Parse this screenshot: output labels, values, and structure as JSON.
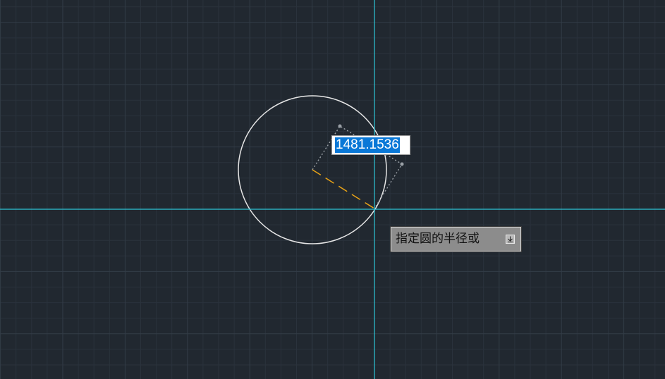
{
  "colors": {
    "background": "#212830",
    "grid_minor": "#2a323c",
    "grid_major": "#333c47",
    "crosshair": "#2ec4d6",
    "circle": "#e6e6e6",
    "radius_line": "#e8a317",
    "dimension_line": "#9aa0a6",
    "input_selection": "#0a78d7",
    "tooltip_bg": "#8c8c8c"
  },
  "dynamic_input": {
    "value": "1481.1536"
  },
  "command_prompt": {
    "text": "指定圆的半径或",
    "options_icon": "down-arrow-options-icon"
  }
}
